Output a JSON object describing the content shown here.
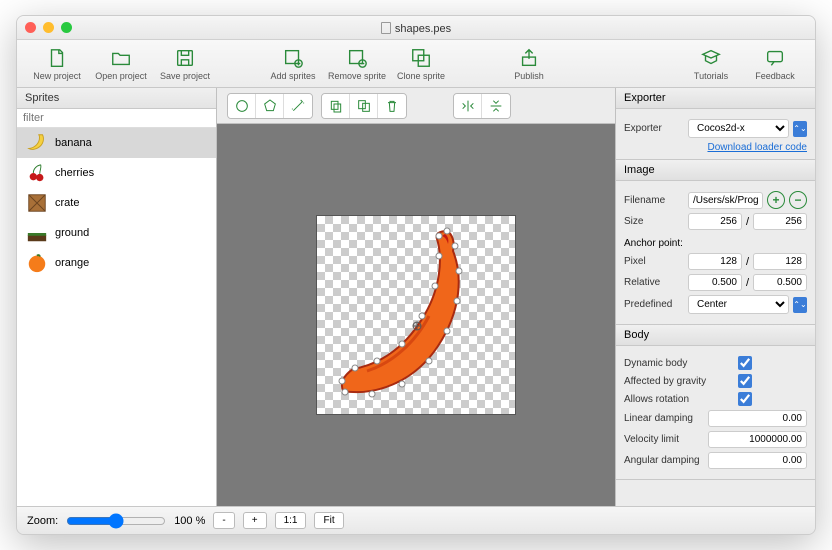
{
  "titlebar": {
    "filename": "shapes.pes"
  },
  "toolbar": {
    "new_project": "New project",
    "open_project": "Open project",
    "save_project": "Save project",
    "add_sprites": "Add sprites",
    "remove_sprite": "Remove sprite",
    "clone_sprite": "Clone sprite",
    "publish": "Publish",
    "tutorials": "Tutorials",
    "feedback": "Feedback"
  },
  "sidebar": {
    "header": "Sprites",
    "filter_placeholder": "filter",
    "items": [
      {
        "label": "banana"
      },
      {
        "label": "cherries"
      },
      {
        "label": "crate"
      },
      {
        "label": "ground"
      },
      {
        "label": "orange"
      }
    ]
  },
  "inspector": {
    "exporter": {
      "header": "Exporter",
      "label": "Exporter",
      "value": "Cocos2d-x",
      "download_link": "Download loader code"
    },
    "image": {
      "header": "Image",
      "filename_label": "Filename",
      "filename_value": "/Users/sk/Program",
      "size_label": "Size",
      "size_w": "256",
      "size_h": "256",
      "anchor_label": "Anchor point:",
      "pixel_label": "Pixel",
      "pixel_x": "128",
      "pixel_y": "128",
      "relative_label": "Relative",
      "relative_x": "0.500",
      "relative_y": "0.500",
      "predefined_label": "Predefined",
      "predefined_value": "Center"
    },
    "body": {
      "header": "Body",
      "dynamic_label": "Dynamic body",
      "gravity_label": "Affected by gravity",
      "rotation_label": "Allows rotation",
      "linear_damping_label": "Linear damping",
      "linear_damping_value": "0.00",
      "velocity_limit_label": "Velocity limit",
      "velocity_limit_value": "1000000.00",
      "angular_damping_label": "Angular damping",
      "angular_damping_value": "0.00"
    }
  },
  "footer": {
    "zoom_label": "Zoom:",
    "zoom_value": "100 %",
    "minus": "-",
    "plus": "+",
    "one_to_one": "1:1",
    "fit": "Fit"
  }
}
